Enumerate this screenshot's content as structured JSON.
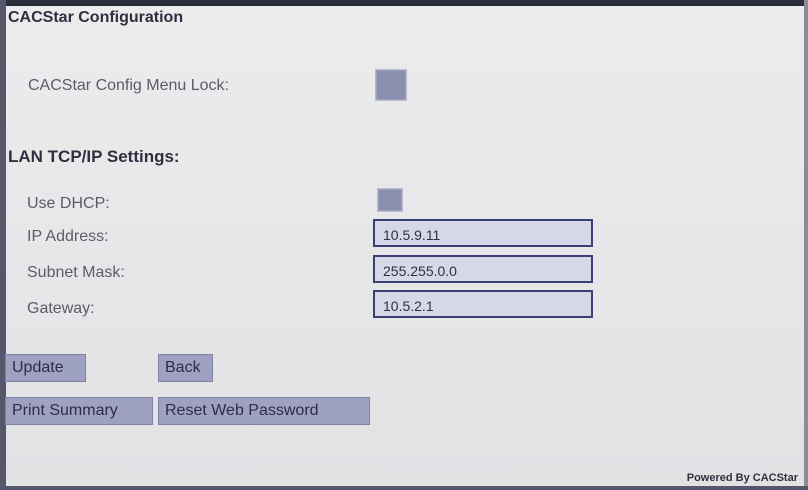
{
  "title": "CACStar Configuration",
  "config_lock": {
    "label": "CACStar Config Menu Lock:",
    "checked": false
  },
  "lan": {
    "heading": "LAN TCP/IP Settings:",
    "dhcp_label": "Use DHCP:",
    "dhcp_checked": false,
    "ip_label": "IP Address:",
    "ip_value": "10.5.9.11",
    "subnet_label": "Subnet Mask:",
    "subnet_value": "255.255.0.0",
    "gateway_label": "Gateway:",
    "gateway_value": "10.5.2.1"
  },
  "buttons": {
    "update": "Update",
    "back": "Back",
    "print_summary": "Print Summary",
    "reset_password": "Reset Web Password"
  },
  "footer": "Powered By CACStar",
  "colors": {
    "accent": "#9ea1c2",
    "field_bg": "#d6d8e8",
    "field_border": "#3b3f78",
    "checkbox": "#8a8faf"
  }
}
